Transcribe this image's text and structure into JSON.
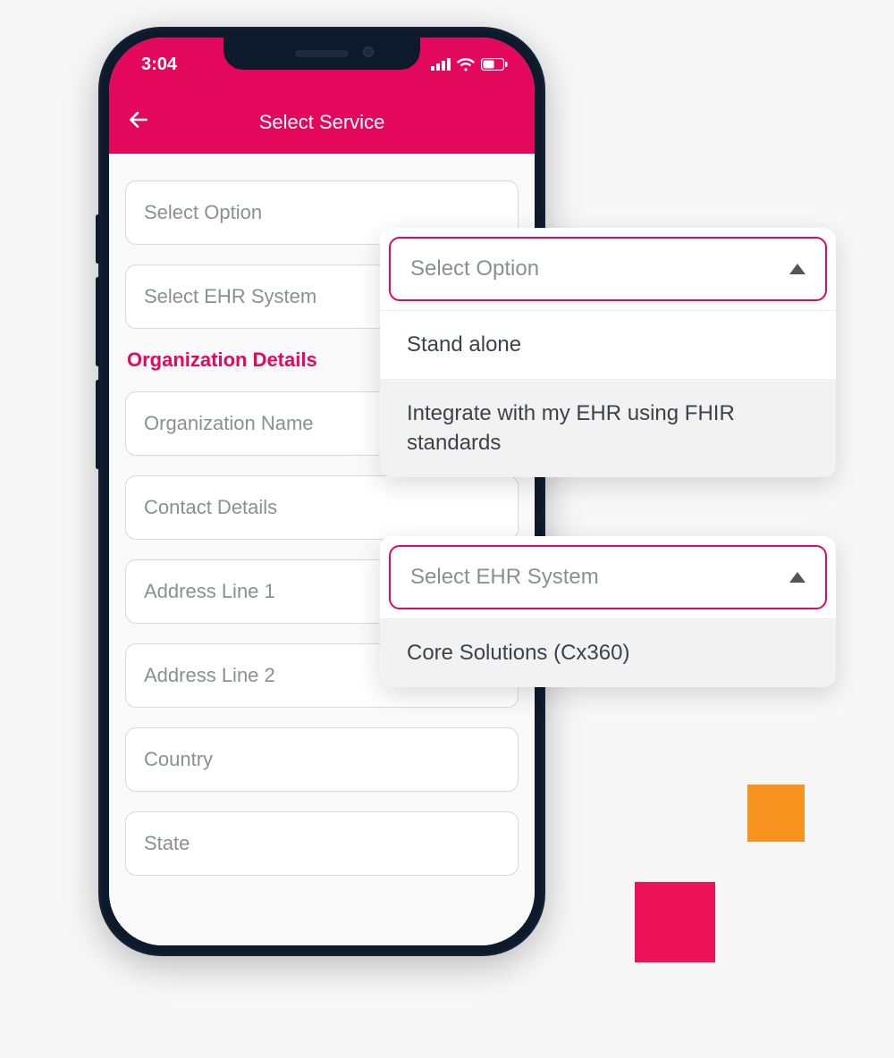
{
  "statusbar": {
    "time": "3:04"
  },
  "header": {
    "title": "Select Service"
  },
  "form": {
    "select_option_placeholder": "Select Option",
    "select_ehr_placeholder": "Select EHR System",
    "section_title": "Organization Details",
    "fields": {
      "org_name": "Organization Name",
      "contact": "Contact Details",
      "addr1": "Address Line 1",
      "addr2": "Address Line 2",
      "country": "Country",
      "state": "State"
    }
  },
  "dropdown1": {
    "label": "Select Option",
    "options": [
      "Stand alone",
      "Integrate with my EHR using FHIR standards"
    ]
  },
  "dropdown2": {
    "label": "Select EHR System",
    "options": [
      "Core Solutions (Cx360)"
    ]
  }
}
